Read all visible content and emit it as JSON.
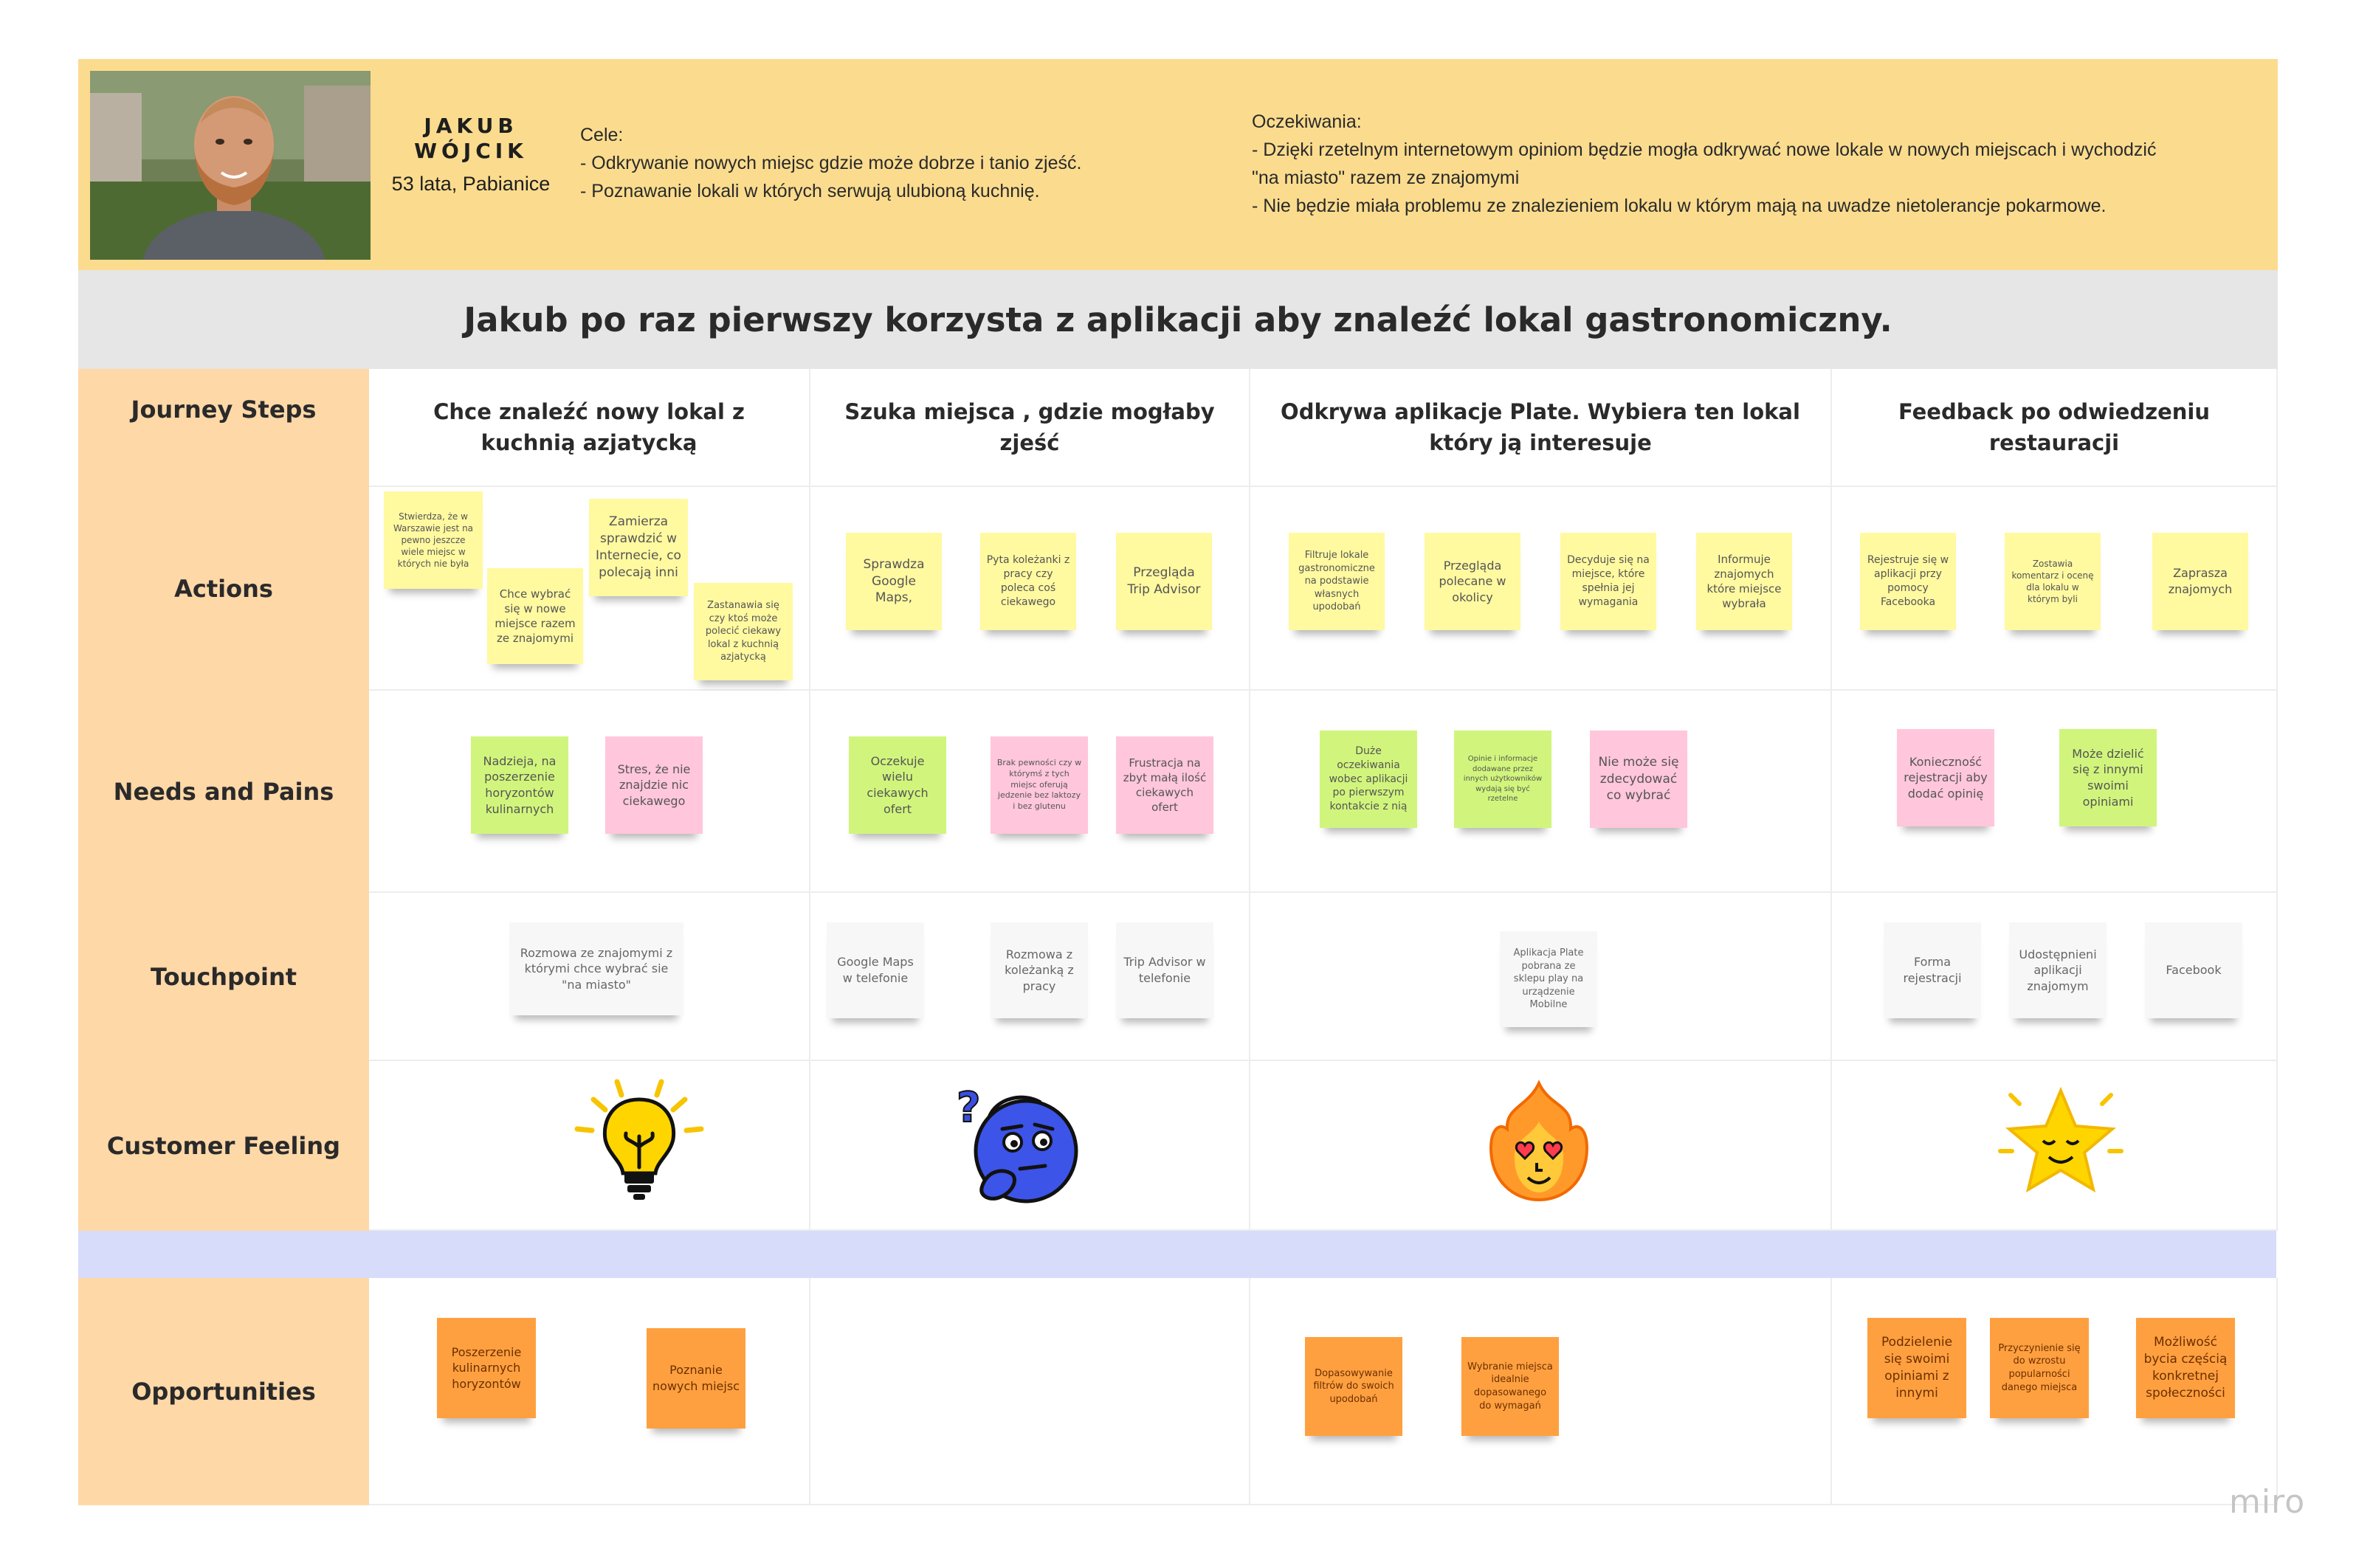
{
  "persona": {
    "name": "JAKUB\nWÓJCIK",
    "info": "53 lata, Pabianice",
    "goals": "Cele:\n- Odkrywanie nowych miejsc gdzie może dobrze i tanio zjeść.\n- Poznawanie lokali w których serwują ulubioną kuchnię.",
    "expectations": "Oczekiwania:\n- Dzięki rzetelnym internetowym opiniom będzie mogła odkrywać nowe lokale w nowych miejscach i wychodzić\n\"na miasto\" razem ze znajomymi\n- Nie będzie miała problemu ze znalezieniem lokalu w którym mają na uwadze nietolerancje pokarmowe."
  },
  "title": "Jakub po raz pierwszy korzysta z aplikacji aby znaleźć lokal gastronomiczny.",
  "rows": {
    "steps": "Journey Steps",
    "actions": "Actions",
    "needs": "Needs and Pains",
    "touch": "Touchpoint",
    "feeling": "Customer Feeling",
    "opps": "Opportunities"
  },
  "steps": [
    "Chce znaleźć nowy lokal z kuchnią azjatycką",
    "Szuka miejsca , gdzie mogłaby zjeść",
    "Odkrywa aplikacje Plate. Wybiera ten lokal który ją interesuje",
    "Feedback po odwiedzeniu restauracji"
  ],
  "actions": [
    "Stwierdza, że w Warszawie jest na pewno jeszcze wiele miejsc w których nie była",
    "Chce wybrać się w nowe miejsce razem ze znajomymi",
    "Zamierza sprawdzić w Internecie, co polecają inni",
    "Zastanawia się czy ktoś może polecić ciekawy lokal z kuchnią azjatycką",
    "Sprawdza Google Maps,",
    "Pyta koleżanki z pracy czy poleca coś ciekawego",
    "Przegląda Trip Advisor",
    "Filtruje lokale gastronomiczne na podstawie własnych upodobań",
    "Przegląda polecane w okolicy",
    "Decyduje się na miejsce, które spełnia jej wymagania",
    "Informuje znajomych które miejsce wybrała",
    "Rejestruje się w aplikacji przy pomocy Facebooka",
    "Zostawia komentarz i ocenę dla lokalu w którym byli",
    "Zaprasza znajomych"
  ],
  "needs": [
    "Nadzieja, na poszerzenie horyzontów kulinarnych",
    "Stres, że nie znajdzie nic ciekawego",
    "Oczekuje wielu ciekawych ofert",
    "Brak pewności czy w którymś z tych miejsc oferują jedzenie bez laktozy i bez glutenu",
    "Frustracja na zbyt małą ilość ciekawych ofert",
    "Duże oczekiwania wobec aplikacji po pierwszym kontakcie z nią",
    "Opinie i informacje dodawane przez innych użytkowników wydają się być rzetelne",
    "Nie może się zdecydować co wybrać",
    "Konieczność rejestracji aby dodać opinię",
    "Może dzielić się z innymi swoimi opiniami"
  ],
  "touch": [
    "Rozmowa ze znajomymi z którymi chce wybrać sie \"na miasto\"",
    "Google Maps w telefonie",
    "Rozmowa z koleżanką z pracy",
    "Trip Advisor w telefonie",
    "Aplikacja Plate pobrana ze sklepu play na urządzenie Mobilne",
    "Forma rejestracji",
    "Udostępnieni aplikacji znajomym",
    "Facebook"
  ],
  "feelings": [
    "lightbulb-icon",
    "thinking-face-icon",
    "heart-eyes-fire-icon",
    "happy-star-icon"
  ],
  "opps": [
    "Poszerzenie kulinarnych horyzontów",
    "Poznanie nowych miejsc",
    "Dopasowywanie filtrów do swoich upodobań",
    "Wybranie miejsca idealnie dopasowanego do wymagań",
    "Podzielenie się swoimi opiniami z innymi",
    "Przyczynienie się do wzrostu popularności danego miejsca",
    "Możliwość bycia częścią konkretnej społeczności"
  ],
  "brand": "miro",
  "colors": {
    "header": "#fbdc8e",
    "row_header": "#ffd8a8",
    "separator": "#d7dcfb",
    "note_yellow": "#fff9a0",
    "note_green": "#d1f57c",
    "note_pink": "#ffc6dc",
    "note_orange": "#ffa040"
  }
}
